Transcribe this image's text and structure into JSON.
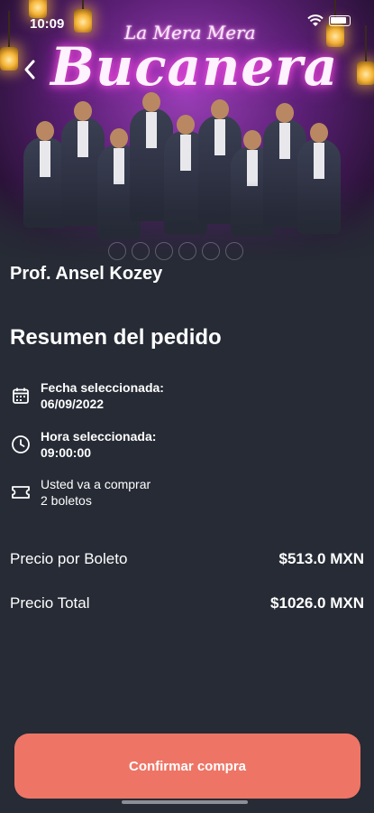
{
  "status_bar": {
    "time": "10:09"
  },
  "hero": {
    "band_name_small": "La Mera Mera",
    "band_name_big": "Bucanera"
  },
  "artist": {
    "name": "Prof. Ansel Kozey"
  },
  "summary": {
    "title": "Resumen del pedido",
    "date_label": "Fecha seleccionada:",
    "date_value": "06/09/2022",
    "time_label": "Hora seleccionada:",
    "time_value": "09:00:00",
    "tickets_line1": "Usted va a comprar",
    "tickets_line2": "2 boletos"
  },
  "prices": {
    "per_ticket_label": "Precio por Boleto",
    "per_ticket_value": "$513.0 MXN",
    "total_label": "Precio Total",
    "total_value": "$1026.0 MXN"
  },
  "actions": {
    "confirm_label": "Confirmar compra"
  },
  "icons": {
    "back": "chevron-left-icon",
    "calendar": "calendar-icon",
    "clock": "clock-icon",
    "ticket": "ticket-icon"
  },
  "colors": {
    "background": "#262b35",
    "accent": "#ee7566",
    "text": "#ffffff"
  }
}
